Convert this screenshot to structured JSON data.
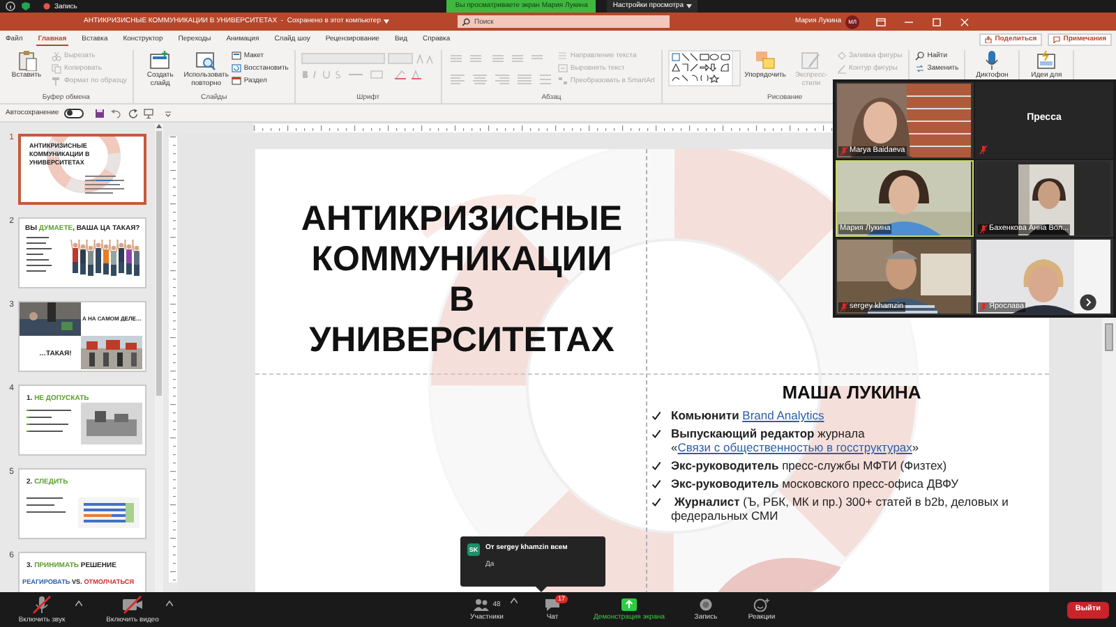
{
  "zoom_top": {
    "recording": "Запись",
    "banner": "Вы просматриваете экран Мария Лукина",
    "view_options": "Настройки просмотра"
  },
  "title_bar": {
    "title": "АНТИКРИЗИСНЫЕ КОММУНИКАЦИИ В УНИВЕРСИТЕТАХ  -  Сохранено в этот компьютер",
    "search_placeholder": "Поиск",
    "user": "Мария Лукина",
    "avatar": "МЛ"
  },
  "ribbon_tabs": [
    {
      "label": "Файл",
      "selected": false
    },
    {
      "label": "Главная",
      "selected": true
    },
    {
      "label": "Вставка",
      "selected": false
    },
    {
      "label": "Конструктор",
      "selected": false
    },
    {
      "label": "Переходы",
      "selected": false
    },
    {
      "label": "Анимация",
      "selected": false
    },
    {
      "label": "Слайд шоу",
      "selected": false
    },
    {
      "label": "Рецензирование",
      "selected": false
    },
    {
      "label": "Вид",
      "selected": false
    },
    {
      "label": "Справка",
      "selected": false
    }
  ],
  "ribbon_actions": [
    "Поделиться",
    "Примечания"
  ],
  "ribbon_groups": [
    {
      "label": "Буфер обмена",
      "items": [
        {
          "kind": "large",
          "label": "Вставить",
          "disabled": false
        },
        {
          "kind": "small",
          "label": "Вырезать",
          "disabled": true
        },
        {
          "kind": "small",
          "label": "Копировать",
          "disabled": true
        },
        {
          "kind": "small",
          "label": "Формат по образцу",
          "disabled": true
        }
      ]
    },
    {
      "label": "Слайды",
      "items": [
        {
          "kind": "large",
          "label": "Создать слайд",
          "disabled": false
        },
        {
          "kind": "large",
          "label": "Использовать повторно",
          "disabled": false
        },
        {
          "kind": "small",
          "label": "Макет",
          "disabled": false
        },
        {
          "kind": "small",
          "label": "Восстановить",
          "disabled": false
        },
        {
          "kind": "small",
          "label": "Раздел",
          "disabled": false
        }
      ]
    },
    {
      "label": "Шрифт",
      "items": [
        {
          "kind": "font"
        }
      ]
    },
    {
      "label": "Абзац",
      "items": [
        {
          "kind": "paragraph"
        },
        {
          "kind": "small",
          "label": "Направление текста",
          "disabled": true
        },
        {
          "kind": "small",
          "label": "Выровнять текст",
          "disabled": true
        },
        {
          "kind": "small",
          "label": "Преобразовать в SmartArt",
          "disabled": true
        }
      ]
    },
    {
      "label": "Рисование",
      "items": [
        {
          "kind": "gallery"
        },
        {
          "kind": "large",
          "label": "Упорядочить",
          "disabled": false
        },
        {
          "kind": "large",
          "label": "Экспресс-стили",
          "disabled": true
        },
        {
          "kind": "small",
          "label": "Заливка фигуры",
          "disabled": true
        },
        {
          "kind": "small",
          "label": "Контур фигуры",
          "disabled": true
        }
      ]
    },
    {
      "items": [
        {
          "kind": "small",
          "label": "Найти",
          "disabled": false
        },
        {
          "kind": "small",
          "label": "Заменить",
          "disabled": false
        }
      ]
    },
    {
      "items": [
        {
          "kind": "large",
          "label": "Диктофон",
          "disabled": false
        }
      ]
    },
    {
      "items": [
        {
          "kind": "large",
          "label": "Идеи для",
          "disabled": false
        }
      ]
    }
  ],
  "quick_access": {
    "autosave_label": "Автосохранение",
    "autosave_on": false
  },
  "thumbnails": [
    {
      "number": "1",
      "selected": true,
      "kind": "title",
      "title": [
        {
          "text": "АНТИКРИЗИСНЫЕ КОММУНИКАЦИИ В УНИВЕРСИТЕТАХ",
          "color": "#222222"
        }
      ]
    },
    {
      "number": "2",
      "selected": false,
      "title": [
        {
          "text": "ВЫ ",
          "color": "#222222"
        },
        {
          "text": "ДУМАЕТЕ",
          "color": "#5aa02c"
        },
        {
          "text": ", ВАША ЦА ТАКАЯ?",
          "color": "#222222"
        }
      ]
    },
    {
      "number": "3",
      "selected": false,
      "kind": "quad",
      "title": [
        {
          "text": "А НА САМОМ ДЕЛЕ…",
          "color": "#222222"
        }
      ],
      "caption": "…ТАКАЯ!"
    },
    {
      "number": "4",
      "selected": false,
      "kind": "text-image",
      "title": [
        {
          "text": "1. ",
          "color": "#222222"
        },
        {
          "text": "НЕ ДОПУСКАТЬ",
          "color": "#5aa02c"
        }
      ]
    },
    {
      "number": "5",
      "selected": false,
      "kind": "chart",
      "title": [
        {
          "text": "2. ",
          "color": "#222222"
        },
        {
          "text": "СЛЕДИТЬ",
          "color": "#5aa02c"
        }
      ]
    },
    {
      "number": "6",
      "selected": false,
      "kind": "versus",
      "title": [
        {
          "text": "3. ",
          "color": "#222222"
        },
        {
          "text": "ПРИНИМАТЬ",
          "color": "#5aa02c"
        },
        {
          "text": " РЕШЕНИЕ",
          "color": "#222222"
        }
      ],
      "subtitle": [
        {
          "text": "РЕАГИРОВАТЬ",
          "color": "#2e5da8"
        },
        {
          "text": " VS. ",
          "color": "#222222"
        },
        {
          "text": "ОТМОЛЧАТЬСЯ",
          "color": "#d42a2a"
        }
      ]
    }
  ],
  "slide": {
    "title": "АНТИКРИЗИСНЫЕ КОММУНИКАЦИИ В УНИВЕРСИТЕТАХ",
    "speaker": "МАША ЛУКИНА",
    "bullets": [
      [
        {
          "kind": "bold",
          "text": "Комьюнити "
        },
        {
          "kind": "link",
          "text": "Brand Analytics"
        }
      ],
      [
        {
          "kind": "bold",
          "text": "Выпускающий редактор"
        },
        {
          "kind": "plain",
          "text": " журнала «"
        },
        {
          "kind": "link",
          "text": "Связи с общественностью в госструктурах"
        },
        {
          "kind": "plain",
          "text": "»"
        }
      ],
      [
        {
          "kind": "bold",
          "text": "Экс-руководитель"
        },
        {
          "kind": "plain",
          "text": " пресс-службы МФТИ (Физтех)"
        }
      ],
      [
        {
          "kind": "bold",
          "text": "Экс-руководитель"
        },
        {
          "kind": "plain",
          "text": " московского пресс-офиса ДВФУ"
        }
      ],
      [
        {
          "kind": "bold",
          "text": " Журналист"
        },
        {
          "kind": "plain",
          "text": " (Ъ, РБК, МК и пр.) 300+ статей в b2b, деловых и федеральных СМИ"
        }
      ]
    ]
  },
  "participants": [
    {
      "name": "Marya Baidaeva",
      "kind": "video",
      "muted": true,
      "selected": false
    },
    {
      "name": "Пресса",
      "kind": "name",
      "muted": true,
      "selected": false
    },
    {
      "name": "Мария Лукина",
      "kind": "video",
      "muted": false,
      "selected": true
    },
    {
      "name": "Бахенкова Анна Вол...",
      "kind": "video",
      "muted": true,
      "selected": false
    },
    {
      "name": "sergey khamzin",
      "kind": "video",
      "muted": true,
      "selected": false
    },
    {
      "name": "Ярослава",
      "kind": "video",
      "muted": true,
      "selected": false
    }
  ],
  "chat_popup": {
    "avatar": "SK",
    "sender": "От sergey khamzin всем",
    "message": "Да"
  },
  "toolbar": {
    "left": [
      {
        "kind": "audio",
        "label": "Включить звук",
        "off": true
      },
      {
        "kind": "video",
        "label": "Включить видео",
        "off": true
      }
    ],
    "center": [
      {
        "kind": "participants",
        "label": "Участники",
        "count": "48"
      },
      {
        "kind": "chat",
        "label": "Чат",
        "badge": "17"
      },
      {
        "kind": "share",
        "label": "Демонстрация экрана"
      },
      {
        "kind": "record",
        "label": "Запись"
      },
      {
        "kind": "reactions",
        "label": "Реакции"
      }
    ],
    "leave": "Выйти"
  }
}
